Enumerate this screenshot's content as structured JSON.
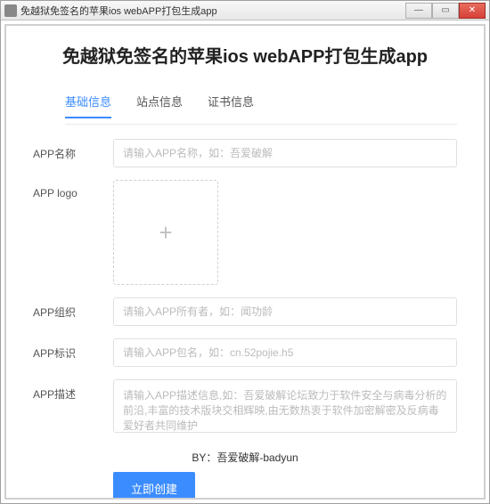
{
  "window": {
    "title": "免越狱免签名的苹果ios webAPP打包生成app"
  },
  "page": {
    "title": "免越狱免签名的苹果ios webAPP打包生成app"
  },
  "tabs": {
    "basic": "基础信息",
    "site": "站点信息",
    "cert": "证书信息"
  },
  "form": {
    "name": {
      "label": "APP名称",
      "placeholder": "请输入APP名称，如：吾爱破解"
    },
    "logo": {
      "label": "APP logo"
    },
    "org": {
      "label": "APP组织",
      "placeholder": "请输入APP所有者，如：闻功龄"
    },
    "id": {
      "label": "APP标识",
      "placeholder": "请输入APP包名，如：cn.52pojie.h5"
    },
    "desc": {
      "label": "APP描述",
      "placeholder": "请输入APP描述信息,如：吾爱破解论坛致力于软件安全与病毒分析的前沿,丰富的技术版块交相辉映,由无数热衷于软件加密解密及反病毒爱好者共同维护"
    }
  },
  "footer": {
    "byline": "BY：吾爱破解-badyun"
  },
  "buttons": {
    "submit": "立即创建"
  }
}
